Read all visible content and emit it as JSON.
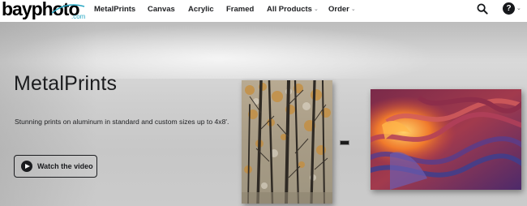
{
  "header": {
    "logo": {
      "text_main": "bayphoto",
      "text_suffix": ".com"
    },
    "nav": [
      {
        "label": "MetalPrints",
        "has_dropdown": false
      },
      {
        "label": "Canvas",
        "has_dropdown": false
      },
      {
        "label": "Acrylic",
        "has_dropdown": false
      },
      {
        "label": "Framed",
        "has_dropdown": false
      },
      {
        "label": "All Products",
        "has_dropdown": true
      },
      {
        "label": "Order",
        "has_dropdown": true
      }
    ],
    "search_icon": "search-icon",
    "help": {
      "symbol": "?",
      "icon": "help-icon"
    }
  },
  "hero": {
    "title": "MetalPrints",
    "subtitle": "Stunning prints on aluminum in standard and custom sizes up to 4x8'.",
    "video_button": {
      "label": "Watch the video",
      "icon": "play-icon"
    }
  },
  "colors": {
    "text_dark": "#1b1c1e",
    "logo_accent": "#2aa8c4",
    "wall_gray": "#cfcfcf"
  }
}
